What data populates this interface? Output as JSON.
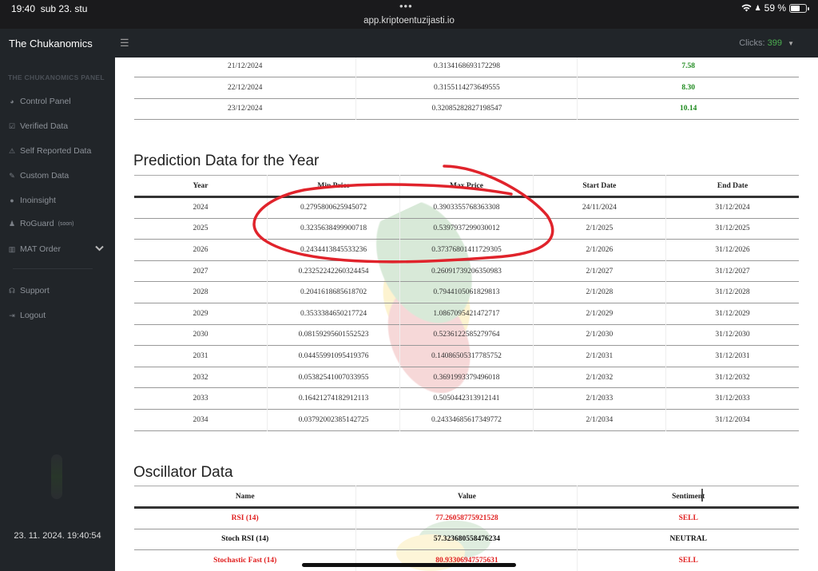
{
  "statusbar": {
    "time": "19:40",
    "date": "sub 23. stu",
    "dots": "•••",
    "url": "app.kriptoentuzijasti.io",
    "battery_percent": "59 %",
    "battery_level": 0.59,
    "icons": [
      "wifi-icon",
      "person-icon",
      "battery-icon"
    ]
  },
  "navbar": {
    "brand": "The Chukanomics",
    "menu_icon": "☰",
    "clicks_label": "Clicks:",
    "clicks_value": "399",
    "caret": "▼"
  },
  "sidebar": {
    "heading": "THE CHUKANOMICS PANEL",
    "items": [
      {
        "label": "Control Panel",
        "icon": "dashboard-icon",
        "glyph": "◕"
      },
      {
        "label": "Verified Data",
        "icon": "checkbox-icon",
        "glyph": "☑"
      },
      {
        "label": "Self Reported Data",
        "icon": "warning-icon",
        "glyph": "⚠"
      },
      {
        "label": "Custom Data",
        "icon": "edit-icon",
        "glyph": "✎"
      },
      {
        "label": "Inoinsight",
        "icon": "info-icon",
        "glyph": "●"
      },
      {
        "label": "RoGuard",
        "sup": "(soon)",
        "icon": "user-shield-icon",
        "glyph": "♟"
      },
      {
        "label": "MAT Order",
        "icon": "chart-icon",
        "glyph": "▥",
        "chevron": "⌄"
      },
      {
        "label": "Support",
        "icon": "headset-icon",
        "glyph": "☊"
      },
      {
        "label": "Logout",
        "icon": "logout-icon",
        "glyph": "⇥"
      }
    ],
    "clock": "23. 11. 2024. 19:40:54"
  },
  "daily_table": {
    "rows": [
      {
        "date": "21/12/2024",
        "price": "0.3134168693172298",
        "change": "7.58"
      },
      {
        "date": "22/12/2024",
        "price": "0.3155114273649555",
        "change": "8.30"
      },
      {
        "date": "23/12/2024",
        "price": "0.32085282827198547",
        "change": "10.14"
      }
    ]
  },
  "prediction": {
    "title": "Prediction Data for the Year",
    "headers": [
      "Year",
      "Min Price",
      "Max Price",
      "Start Date",
      "End Date"
    ],
    "rows": [
      {
        "year": "2024",
        "min": "0.2795800625945072",
        "max": "0.3903355768363308",
        "start": "24/11/2024",
        "end": "31/12/2024"
      },
      {
        "year": "2025",
        "min": "0.3235638499900718",
        "max": "0.5397937299030012",
        "start": "2/1/2025",
        "end": "31/12/2025"
      },
      {
        "year": "2026",
        "min": "0.2434413845533236",
        "max": "0.37376801411729305",
        "start": "2/1/2026",
        "end": "31/12/2026"
      },
      {
        "year": "2027",
        "min": "0.23252242260324454",
        "max": "0.26091739206350983",
        "start": "2/1/2027",
        "end": "31/12/2027"
      },
      {
        "year": "2028",
        "min": "0.2041618685618702",
        "max": "0.7944105061829813",
        "start": "2/1/2028",
        "end": "31/12/2028"
      },
      {
        "year": "2029",
        "min": "0.3533384650217724",
        "max": "1.0867095421472717",
        "start": "2/1/2029",
        "end": "31/12/2029"
      },
      {
        "year": "2030",
        "min": "0.08159295601552523",
        "max": "0.5236122585279764",
        "start": "2/1/2030",
        "end": "31/12/2030"
      },
      {
        "year": "2031",
        "min": "0.04455991095419376",
        "max": "0.14086505317785752",
        "start": "2/1/2031",
        "end": "31/12/2031"
      },
      {
        "year": "2032",
        "min": "0.05382541007033955",
        "max": "0.3691993379496018",
        "start": "2/1/2032",
        "end": "31/12/2032"
      },
      {
        "year": "2033",
        "min": "0.16421274182912113",
        "max": "0.5050442313912141",
        "start": "2/1/2033",
        "end": "31/12/2033"
      },
      {
        "year": "2034",
        "min": "0.03792002385142725",
        "max": "0.24334685617349772",
        "start": "2/1/2034",
        "end": "31/12/2034"
      }
    ]
  },
  "oscillator": {
    "title": "Oscillator Data",
    "headers": [
      "Name",
      "Value",
      "Sentiment"
    ],
    "rows": [
      {
        "name": "RSI (14)",
        "value": "77.26058775921528",
        "sentiment": "SELL",
        "class": "sell"
      },
      {
        "name": "Stoch RSI (14)",
        "value": "57.323680558476234",
        "sentiment": "NEUTRAL",
        "class": "neutral"
      },
      {
        "name": "Stochastic Fast (14)",
        "value": "80.93306947575631",
        "sentiment": "SELL",
        "class": "sell"
      }
    ]
  },
  "colors": {
    "positive": "#1d8a1d",
    "sell": "#e02020",
    "annotation": "#e0232b",
    "clicks": "#4caf50"
  }
}
